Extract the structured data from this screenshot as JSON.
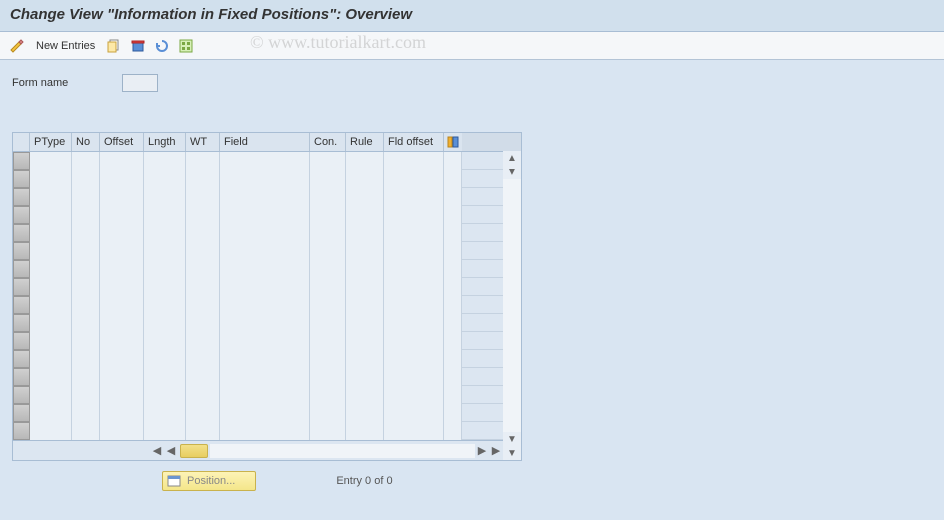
{
  "title": "Change View \"Information in Fixed Positions\": Overview",
  "watermark": "© www.tutorialkart.com",
  "toolbar": {
    "new_entries": "New Entries"
  },
  "form": {
    "label": "Form name",
    "value": ""
  },
  "table": {
    "columns": [
      "PType",
      "No",
      "Offset",
      "Lngth",
      "WT",
      "Field",
      "Con.",
      "Rule",
      "Fld offset"
    ],
    "rows": 16
  },
  "footer": {
    "position": "Position...",
    "entry": "Entry 0 of 0"
  }
}
